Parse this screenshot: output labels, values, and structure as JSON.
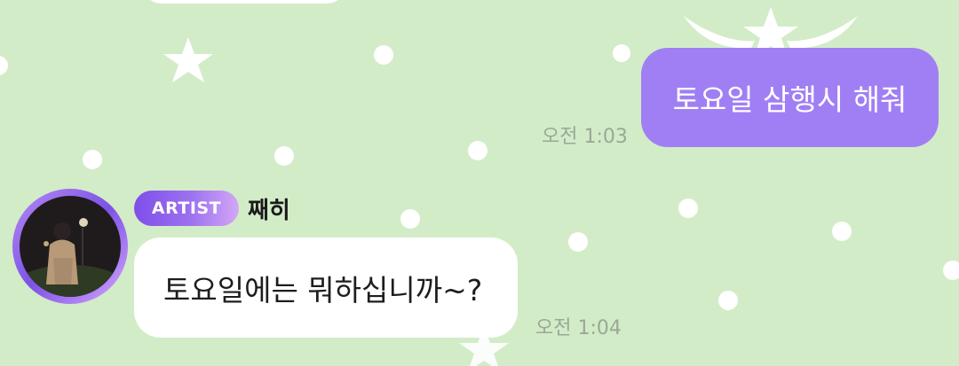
{
  "background_color": "#d3ecc8",
  "outgoing_message": {
    "text": "토요일 삼행시 해줘",
    "time": "오전 1:03",
    "bubble_color": "#a07ff4"
  },
  "incoming_message": {
    "badge": "ARTIST",
    "sender": "째히",
    "text": "토요일에는 뭐하십니까~?",
    "time": "오전 1:04",
    "bubble_color": "#ffffff"
  },
  "icons": {
    "avatar": "artist-profile-photo",
    "decorations": [
      "star-icon",
      "dot-pattern",
      "winged-star-icon"
    ]
  }
}
